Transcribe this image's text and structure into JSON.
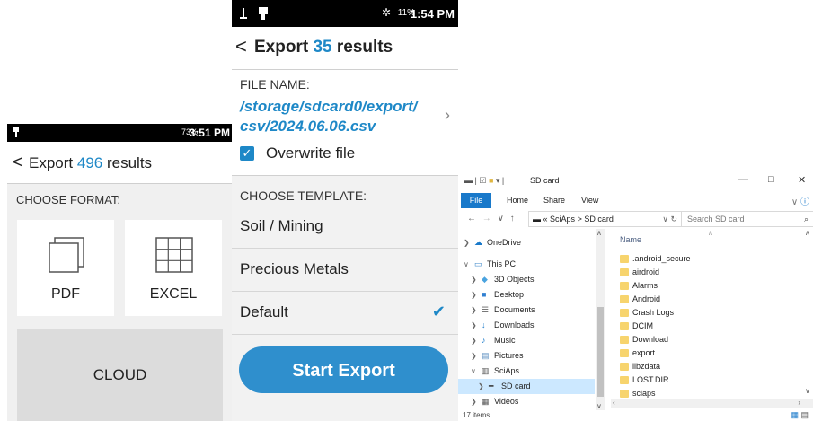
{
  "panel_format": {
    "status": {
      "battery": "73%",
      "time": "3:51 PM"
    },
    "header": {
      "back": "<",
      "title_prefix": "Export",
      "count": "496",
      "title_suffix": "results"
    },
    "choose_label": "CHOOSE FORMAT:",
    "formats": {
      "pdf": "PDF",
      "excel": "EXCEL",
      "cloud": "CLOUD"
    }
  },
  "panel_export": {
    "status": {
      "battery": "11%",
      "time": "1:54 PM"
    },
    "header": {
      "back": "<",
      "title_prefix": "Export",
      "count": "35",
      "title_suffix": "results"
    },
    "file_name_label": "FILE NAME:",
    "file_path_line1": "/storage/sdcard0/export/",
    "file_path_line2": "csv/2024.06.06.csv",
    "overwrite": {
      "label": "Overwrite file",
      "checked": true
    },
    "template_label": "CHOOSE TEMPLATE:",
    "templates": [
      "Soil / Mining",
      "Precious Metals",
      "Default"
    ],
    "selected_template": "Default",
    "start_button": "Start Export"
  },
  "explorer": {
    "title": "SD card",
    "ribbon_tabs": [
      "File",
      "Home",
      "Share",
      "View"
    ],
    "address": {
      "sep": "«",
      "parent": "SciAps",
      "arrow": ">",
      "current": "SD card"
    },
    "search_placeholder": "Search SD card",
    "nav": [
      {
        "label": "OneDrive",
        "icon": "☁"
      },
      {
        "label": "This PC",
        "icon": "▭"
      },
      {
        "label": "3D Objects",
        "icon": "◆"
      },
      {
        "label": "Desktop",
        "icon": "■"
      },
      {
        "label": "Documents",
        "icon": "☰"
      },
      {
        "label": "Downloads",
        "icon": "↓"
      },
      {
        "label": "Music",
        "icon": "♪"
      },
      {
        "label": "Pictures",
        "icon": "▤"
      },
      {
        "label": "SciAps",
        "icon": "▥"
      },
      {
        "label": "SD card",
        "icon": "━"
      },
      {
        "label": "Videos",
        "icon": "▦"
      }
    ],
    "column_header": "Name",
    "files": [
      ".android_secure",
      "airdroid",
      "Alarms",
      "Android",
      "Crash Logs",
      "DCIM",
      "Download",
      "export",
      "libzdata",
      "LOST.DIR",
      "sciaps"
    ],
    "status": "17 items",
    "colors": {
      "accent": "#1979ca",
      "folder": "#f7d46e",
      "selection": "#cce8ff"
    }
  },
  "colors": {
    "accent_blue": "#1e88c7",
    "button_blue": "#2f8fcd"
  }
}
